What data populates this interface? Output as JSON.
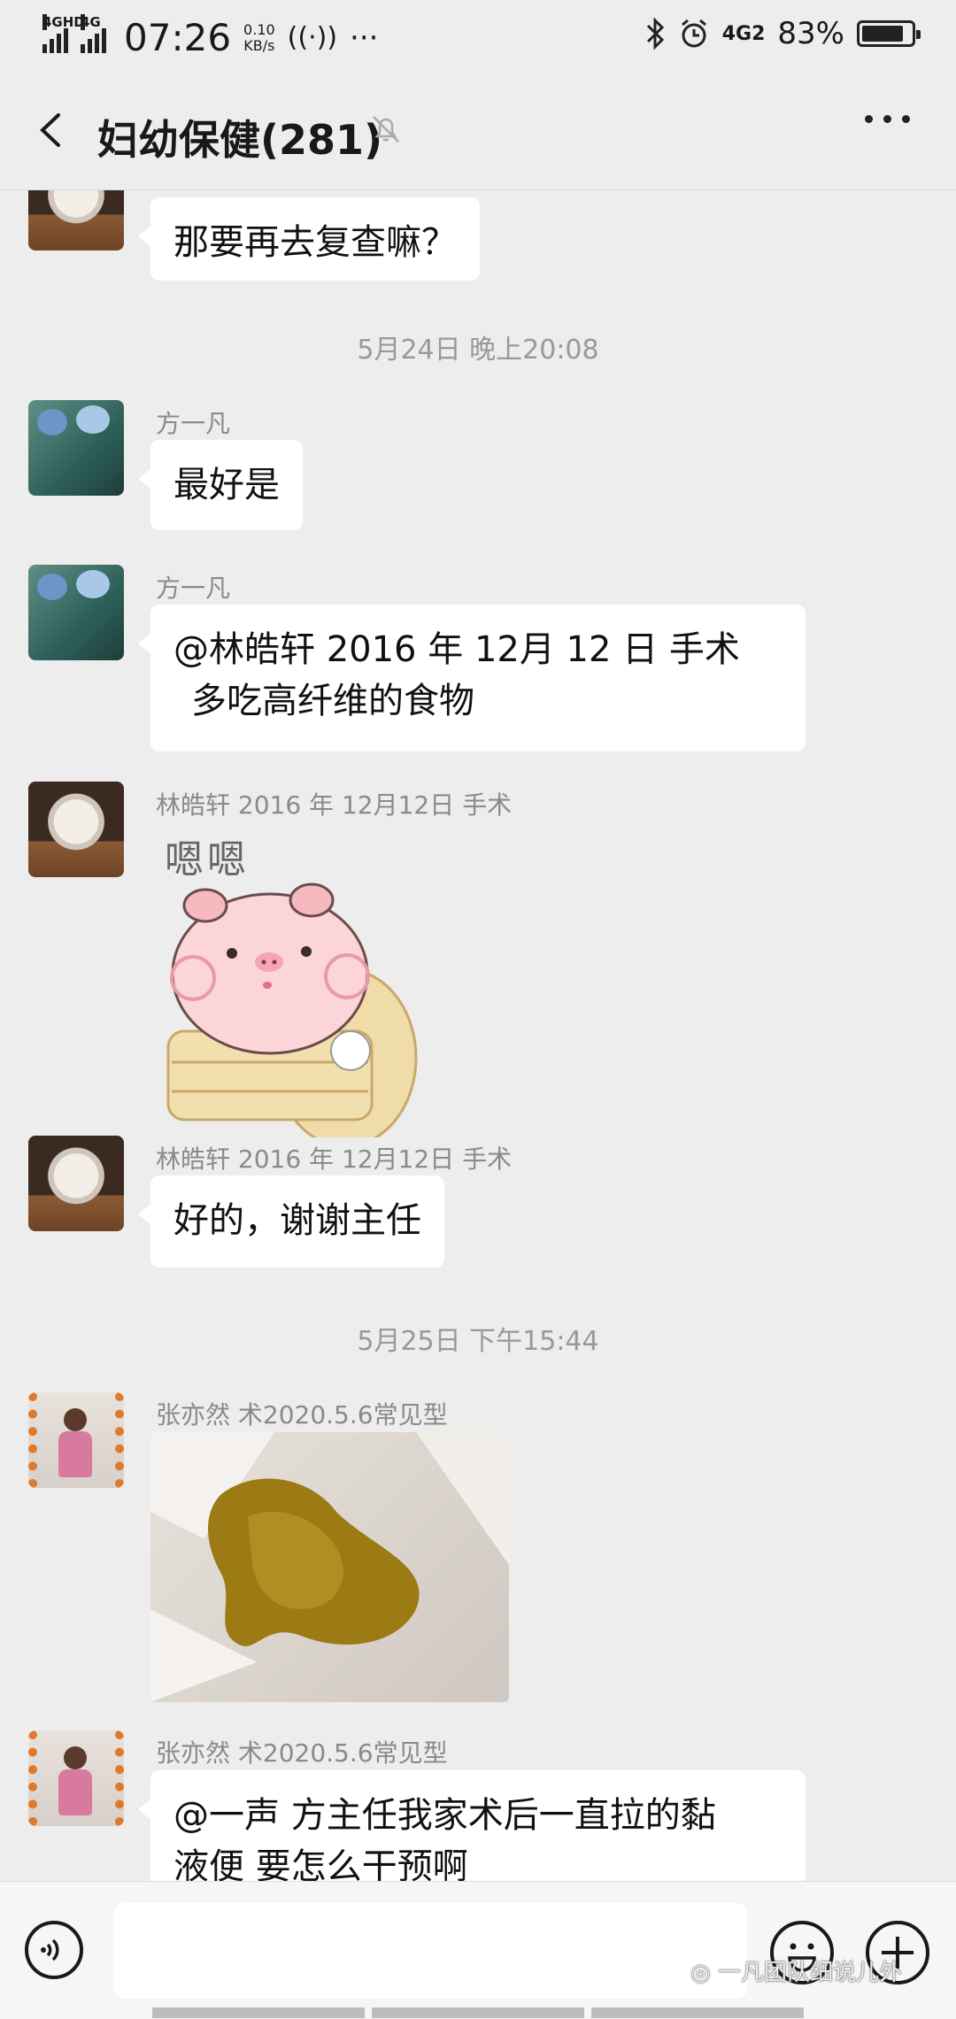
{
  "status_bar": {
    "sim1_label": "4GHD",
    "sim2_label": "4G",
    "time": "07:26",
    "speed_value": "0.10",
    "speed_unit": "KB/s",
    "network_label": "4G2",
    "battery_percent": "83%"
  },
  "header": {
    "title": "妇幼保健(281)"
  },
  "messages": [
    {
      "text": "那要再去复查嘛？"
    },
    {
      "timestamp": "5月24日 晚上20:08"
    },
    {
      "sender": "方一凡",
      "text": "最好是"
    },
    {
      "sender": "方一凡",
      "line1": "@林皓轩   2016 年 12月 12 日 手术",
      "line2": "多吃高纤维的食物"
    },
    {
      "sender": "林皓轩    2016 年 12月12日 手术",
      "sticker_caption": "嗯嗯"
    },
    {
      "sender": "林皓轩    2016 年 12月12日 手术",
      "text": "好的，谢谢主任"
    },
    {
      "timestamp": "5月25日 下午15:44"
    },
    {
      "sender": "张亦然 术2020.5.6常见型"
    },
    {
      "sender": "张亦然 术2020.5.6常见型",
      "line1": "@一声   方主任我家术后一直拉的黏",
      "line2": "液便 要怎么干预啊"
    }
  ],
  "watermark": "一凡团队细说儿外",
  "icons": {
    "back": "chevron-left-icon",
    "mute": "bell-off-icon",
    "more": "more-dots-icon",
    "voice": "voice-icon",
    "emoji": "emoji-icon",
    "plus": "plus-icon"
  }
}
